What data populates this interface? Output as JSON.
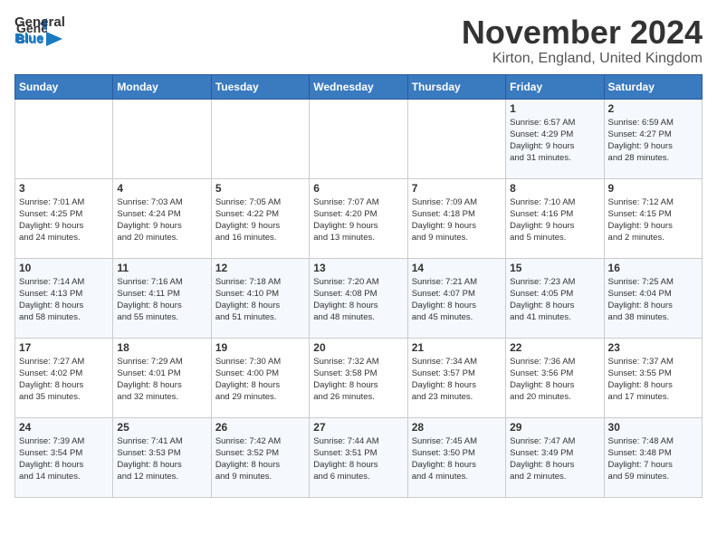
{
  "logo": {
    "general": "General",
    "blue": "Blue"
  },
  "header": {
    "month": "November 2024",
    "location": "Kirton, England, United Kingdom"
  },
  "weekdays": [
    "Sunday",
    "Monday",
    "Tuesday",
    "Wednesday",
    "Thursday",
    "Friday",
    "Saturday"
  ],
  "weeks": [
    [
      {
        "day": "",
        "info": ""
      },
      {
        "day": "",
        "info": ""
      },
      {
        "day": "",
        "info": ""
      },
      {
        "day": "",
        "info": ""
      },
      {
        "day": "",
        "info": ""
      },
      {
        "day": "1",
        "info": "Sunrise: 6:57 AM\nSunset: 4:29 PM\nDaylight: 9 hours\nand 31 minutes."
      },
      {
        "day": "2",
        "info": "Sunrise: 6:59 AM\nSunset: 4:27 PM\nDaylight: 9 hours\nand 28 minutes."
      }
    ],
    [
      {
        "day": "3",
        "info": "Sunrise: 7:01 AM\nSunset: 4:25 PM\nDaylight: 9 hours\nand 24 minutes."
      },
      {
        "day": "4",
        "info": "Sunrise: 7:03 AM\nSunset: 4:24 PM\nDaylight: 9 hours\nand 20 minutes."
      },
      {
        "day": "5",
        "info": "Sunrise: 7:05 AM\nSunset: 4:22 PM\nDaylight: 9 hours\nand 16 minutes."
      },
      {
        "day": "6",
        "info": "Sunrise: 7:07 AM\nSunset: 4:20 PM\nDaylight: 9 hours\nand 13 minutes."
      },
      {
        "day": "7",
        "info": "Sunrise: 7:09 AM\nSunset: 4:18 PM\nDaylight: 9 hours\nand 9 minutes."
      },
      {
        "day": "8",
        "info": "Sunrise: 7:10 AM\nSunset: 4:16 PM\nDaylight: 9 hours\nand 5 minutes."
      },
      {
        "day": "9",
        "info": "Sunrise: 7:12 AM\nSunset: 4:15 PM\nDaylight: 9 hours\nand 2 minutes."
      }
    ],
    [
      {
        "day": "10",
        "info": "Sunrise: 7:14 AM\nSunset: 4:13 PM\nDaylight: 8 hours\nand 58 minutes."
      },
      {
        "day": "11",
        "info": "Sunrise: 7:16 AM\nSunset: 4:11 PM\nDaylight: 8 hours\nand 55 minutes."
      },
      {
        "day": "12",
        "info": "Sunrise: 7:18 AM\nSunset: 4:10 PM\nDaylight: 8 hours\nand 51 minutes."
      },
      {
        "day": "13",
        "info": "Sunrise: 7:20 AM\nSunset: 4:08 PM\nDaylight: 8 hours\nand 48 minutes."
      },
      {
        "day": "14",
        "info": "Sunrise: 7:21 AM\nSunset: 4:07 PM\nDaylight: 8 hours\nand 45 minutes."
      },
      {
        "day": "15",
        "info": "Sunrise: 7:23 AM\nSunset: 4:05 PM\nDaylight: 8 hours\nand 41 minutes."
      },
      {
        "day": "16",
        "info": "Sunrise: 7:25 AM\nSunset: 4:04 PM\nDaylight: 8 hours\nand 38 minutes."
      }
    ],
    [
      {
        "day": "17",
        "info": "Sunrise: 7:27 AM\nSunset: 4:02 PM\nDaylight: 8 hours\nand 35 minutes."
      },
      {
        "day": "18",
        "info": "Sunrise: 7:29 AM\nSunset: 4:01 PM\nDaylight: 8 hours\nand 32 minutes."
      },
      {
        "day": "19",
        "info": "Sunrise: 7:30 AM\nSunset: 4:00 PM\nDaylight: 8 hours\nand 29 minutes."
      },
      {
        "day": "20",
        "info": "Sunrise: 7:32 AM\nSunset: 3:58 PM\nDaylight: 8 hours\nand 26 minutes."
      },
      {
        "day": "21",
        "info": "Sunrise: 7:34 AM\nSunset: 3:57 PM\nDaylight: 8 hours\nand 23 minutes."
      },
      {
        "day": "22",
        "info": "Sunrise: 7:36 AM\nSunset: 3:56 PM\nDaylight: 8 hours\nand 20 minutes."
      },
      {
        "day": "23",
        "info": "Sunrise: 7:37 AM\nSunset: 3:55 PM\nDaylight: 8 hours\nand 17 minutes."
      }
    ],
    [
      {
        "day": "24",
        "info": "Sunrise: 7:39 AM\nSunset: 3:54 PM\nDaylight: 8 hours\nand 14 minutes."
      },
      {
        "day": "25",
        "info": "Sunrise: 7:41 AM\nSunset: 3:53 PM\nDaylight: 8 hours\nand 12 minutes."
      },
      {
        "day": "26",
        "info": "Sunrise: 7:42 AM\nSunset: 3:52 PM\nDaylight: 8 hours\nand 9 minutes."
      },
      {
        "day": "27",
        "info": "Sunrise: 7:44 AM\nSunset: 3:51 PM\nDaylight: 8 hours\nand 6 minutes."
      },
      {
        "day": "28",
        "info": "Sunrise: 7:45 AM\nSunset: 3:50 PM\nDaylight: 8 hours\nand 4 minutes."
      },
      {
        "day": "29",
        "info": "Sunrise: 7:47 AM\nSunset: 3:49 PM\nDaylight: 8 hours\nand 2 minutes."
      },
      {
        "day": "30",
        "info": "Sunrise: 7:48 AM\nSunset: 3:48 PM\nDaylight: 7 hours\nand 59 minutes."
      }
    ]
  ]
}
